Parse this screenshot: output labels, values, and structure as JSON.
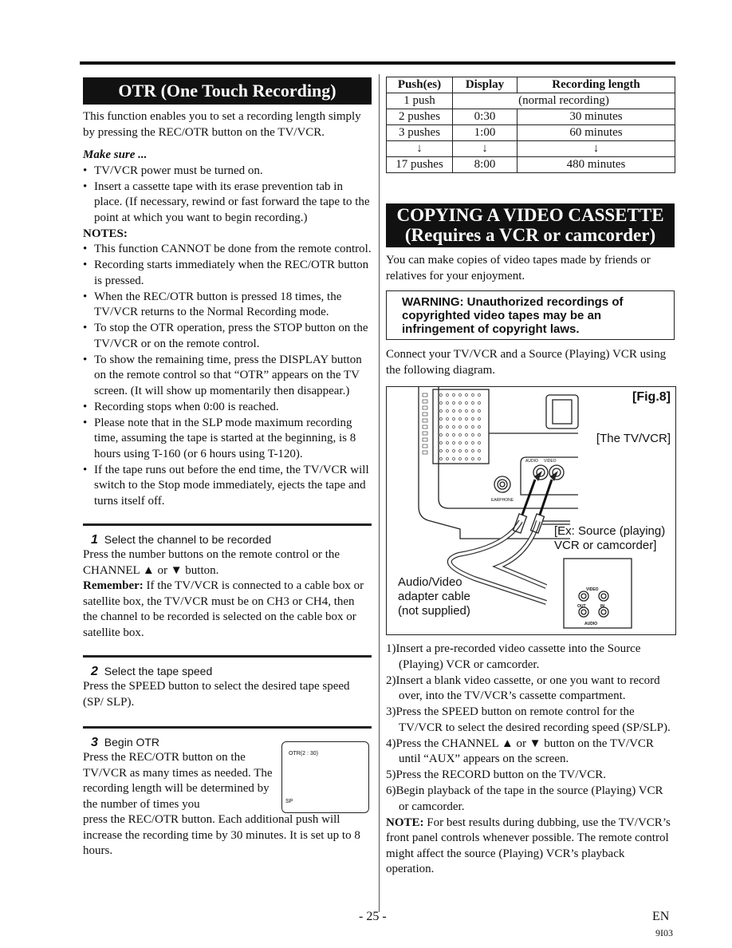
{
  "otr": {
    "title": "OTR (One Touch Recording)",
    "intro": "This function enables you to set a recording length simply by pressing the REC/OTR button on the TV/VCR.",
    "make_sure_label": "Make sure ...",
    "make_sure_items": [
      "TV/VCR power must be turned on.",
      "Insert a cassette tape with its erase prevention tab in place. (If necessary, rewind or fast forward the tape to the point at which you want to begin recording.)"
    ],
    "notes_label": "NOTES:",
    "notes_items": [
      "This function CANNOT be done from the remote control.",
      "Recording starts immediately when the REC/OTR button is pressed.",
      "When the REC/OTR button is pressed 18 times, the TV/VCR returns to the Normal Recording mode.",
      "To stop the OTR operation, press the STOP button on the TV/VCR or on the remote control.",
      "To show the remaining time, press the DISPLAY button on the remote control so that “OTR” appears on the TV screen. (It will show up momentarily then disappear.)",
      "Recording stops when 0:00 is reached.",
      "Please note that in the SLP mode maximum recording time, assuming the tape is started at the beginning, is 8 hours using T-160 (or 6 hours using T-120).",
      "If the tape runs out before the end time, the TV/VCR will switch to the Stop mode immediately, ejects the tape and turns itself off."
    ],
    "steps": [
      {
        "number": "1",
        "title": "Select the channel to be recorded",
        "body": "Press the number buttons on the remote control or the CHANNEL ▲ or ▼ button.",
        "remember_label": "Remember:",
        "remember_text": " If the TV/VCR is connected to a cable box or satellite box, the TV/VCR must be on CH3 or CH4, then the channel to be recorded is selected on the cable box or satellite box."
      },
      {
        "number": "2",
        "title": "Select the tape speed",
        "body": "Press the SPEED button to select the desired tape speed (SP/ SLP)."
      },
      {
        "number": "3",
        "title": "Begin OTR",
        "body_a": "Press the REC/OTR button on the TV/VCR as many times as needed. The recording length will be determined by the number of times you",
        "body_b": "press the REC/OTR button. Each additional push will increase the recording time by 30 minutes. It is set up to 8 hours.",
        "osd_top": "OTR(2 : 30)",
        "osd_bottom": "SP"
      }
    ]
  },
  "table": {
    "headers": [
      "Push(es)",
      "Display",
      "Recording length"
    ],
    "rows": [
      {
        "push": "1 push",
        "merged": "(normal recording)"
      },
      {
        "push": "2 pushes",
        "display": "0:30",
        "length": "30 minutes"
      },
      {
        "push": "3 pushes",
        "display": "1:00",
        "length": "60 minutes"
      },
      {
        "push": "↓",
        "display": "↓",
        "length": "↓"
      },
      {
        "push": "17 pushes",
        "display": "8:00",
        "length": "480 minutes"
      }
    ]
  },
  "copy": {
    "title_line1": "COPYING A VIDEO CASSETTE",
    "title_line2": "(Requires a VCR or camcorder)",
    "intro": "You can make copies of video tapes made by friends or relatives for your enjoyment.",
    "warning": "WARNING: Unauthorized recordings of copyrighted video tapes may be an infringement of copyright laws.",
    "connect": "Connect your TV/VCR and a Source (Playing) VCR using the following diagram.",
    "diagram": {
      "fig_label": "[Fig.8]",
      "tvvcr_label": "[The TV/VCR]",
      "source_label_1": "[Ex: Source (playing)",
      "source_label_2": "VCR or camcorder]",
      "cable_label_1": "Audio/Video",
      "cable_label_2": "adapter cable",
      "cable_label_3": "(not supplied)",
      "jack_audio": "AUDIO",
      "jack_video": "VIDEO",
      "jack_earphone": "EARPHONE",
      "src_video": "VIDEO",
      "src_out": "OUT",
      "src_in": "IN",
      "src_audio": "AUDIO"
    },
    "steps": [
      "1)Insert a pre-recorded video cassette into the Source (Playing) VCR or camcorder.",
      "2)Insert a blank video cassette, or one you want to record over, into the TV/VCR’s cassette compartment.",
      "3)Press the SPEED button on remote control for the TV/VCR to select the desired recording speed (SP/SLP).",
      "4)Press the CHANNEL ▲ or ▼ button on the TV/VCR until “AUX” appears on the screen.",
      "5)Press the RECORD button on the TV/VCR.",
      "6)Begin playback of the tape in the source (Playing) VCR or camcorder."
    ],
    "note_label": "NOTE:",
    "note_text": " For best results during dubbing, use the TV/VCR’s front panel controls whenever possible. The remote control might affect the source (Playing) VCR’s playback operation."
  },
  "footer": {
    "page": "- 25 -",
    "lang": "EN",
    "code": "9I03"
  }
}
